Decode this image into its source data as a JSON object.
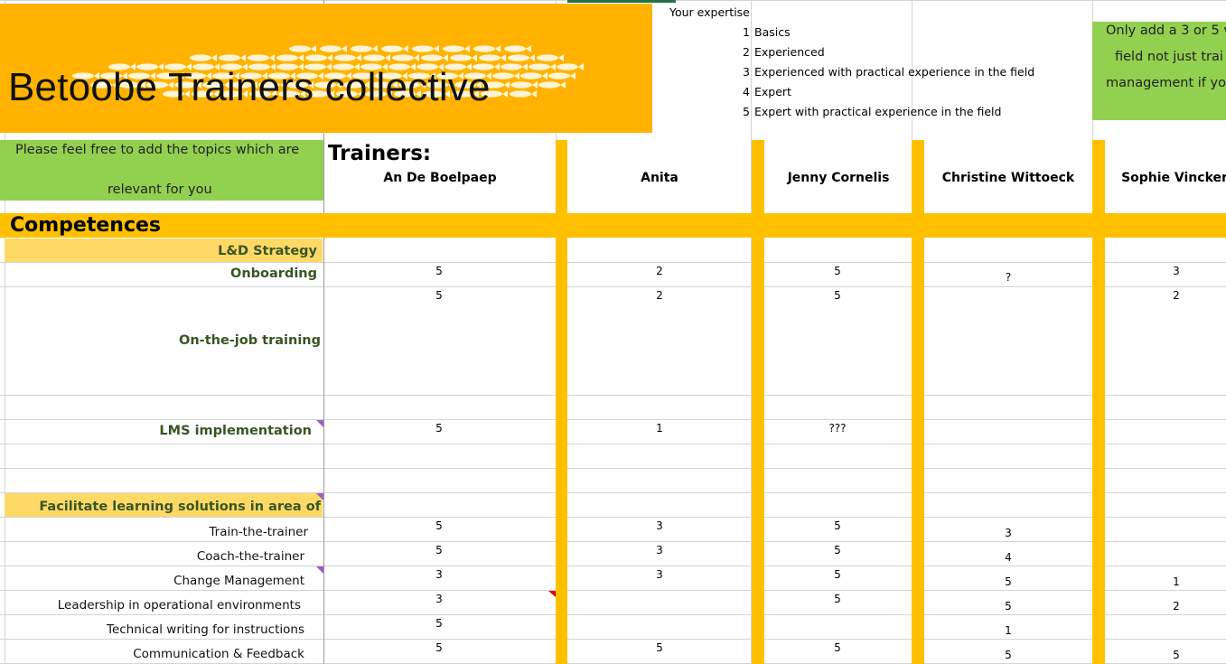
{
  "banner": {
    "title": "Betoobe Trainers collective"
  },
  "expertise_legend": {
    "title": "Your expertise",
    "levels": [
      {
        "num": "1",
        "text": "Basics"
      },
      {
        "num": "2",
        "text": "Experienced"
      },
      {
        "num": "3",
        "text": "Experienced with practical experience in the field"
      },
      {
        "num": "4",
        "text": "Expert"
      },
      {
        "num": "5",
        "text": "Expert with practical experience in the field"
      }
    ]
  },
  "note_left": {
    "line1": "Please feel free to add the topics which are",
    "line2": "relevant for you"
  },
  "note_right": {
    "line1": "Only add a 3 or 5 v",
    "line2": "field not just trai",
    "line3": "management if you"
  },
  "trainers_label": "Trainers:",
  "trainers": [
    "An De Boelpaep",
    "Anita",
    "Jenny Cornelis",
    "Christine Wittoeck",
    "Sophie Vincker"
  ],
  "competences_label": "Competences",
  "rows": {
    "ld_strategy": {
      "label": "L&D Strategy"
    },
    "onboarding": {
      "label": "Onboarding",
      "values": [
        "5",
        "2",
        "5",
        "?",
        "3"
      ]
    },
    "on_the_job": {
      "label": "On-the-job training",
      "values": [
        "5",
        "2",
        "5",
        "",
        "2"
      ]
    },
    "lms": {
      "label": "LMS implementation",
      "values": [
        "5",
        "1",
        "???",
        "",
        ""
      ]
    },
    "facilitate": {
      "label": "Facilitate learning solutions in area of"
    },
    "train_the_trainer": {
      "label": "Train-the-trainer",
      "values": [
        "5",
        "3",
        "5",
        "3",
        ""
      ]
    },
    "coach_the_trainer": {
      "label": "Coach-the-trainer",
      "values": [
        "5",
        "3",
        "5",
        "4",
        ""
      ]
    },
    "change_management": {
      "label": "Change Management",
      "values": [
        "3",
        "3",
        "5",
        "5",
        "1"
      ]
    },
    "leadership": {
      "label": "Leadership  in operational environments",
      "values": [
        "3",
        "",
        "5",
        "5",
        "2"
      ]
    },
    "technical_writing": {
      "label": "Technical writing for instructions",
      "values": [
        "5",
        "",
        "",
        "1",
        ""
      ]
    },
    "communication": {
      "label": "Communication & Feedback",
      "values": [
        "5",
        "5",
        "5",
        "5",
        "5"
      ]
    }
  },
  "colors": {
    "banner": "#ffb300",
    "accent": "#ffc000",
    "note_green": "#92d050",
    "section": "#ffd966",
    "label_green": "#375623"
  }
}
